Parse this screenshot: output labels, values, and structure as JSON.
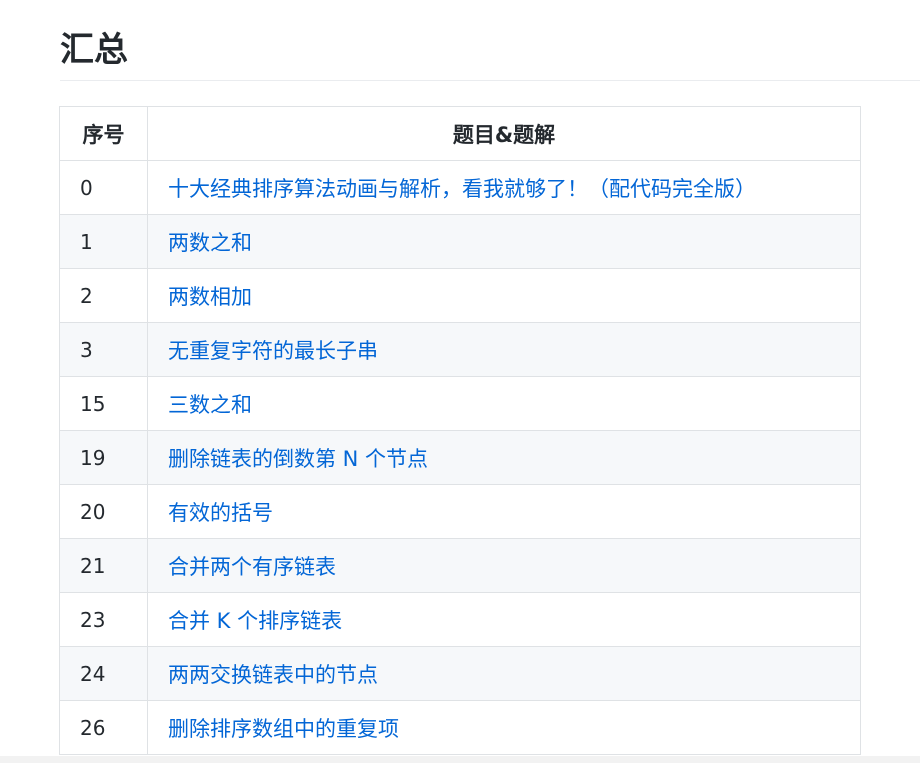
{
  "heading": "汇总",
  "table": {
    "headers": [
      "序号",
      "题目&题解"
    ],
    "rows": [
      {
        "num": "0",
        "title": "十大经典排序算法动画与解析，看我就够了！（配代码完全版）"
      },
      {
        "num": "1",
        "title": "两数之和"
      },
      {
        "num": "2",
        "title": "两数相加"
      },
      {
        "num": "3",
        "title": "无重复字符的最长子串"
      },
      {
        "num": "15",
        "title": "三数之和"
      },
      {
        "num": "19",
        "title": "删除链表的倒数第 N 个节点"
      },
      {
        "num": "20",
        "title": "有效的括号"
      },
      {
        "num": "21",
        "title": "合并两个有序链表"
      },
      {
        "num": "23",
        "title": "合并 K 个排序链表"
      },
      {
        "num": "24",
        "title": "两两交换链表中的节点"
      },
      {
        "num": "26",
        "title": "删除排序数组中的重复项"
      }
    ]
  },
  "colors": {
    "link": "#0366d6",
    "text": "#24292e",
    "border": "#dfe2e5",
    "stripe": "#f6f8fa"
  }
}
